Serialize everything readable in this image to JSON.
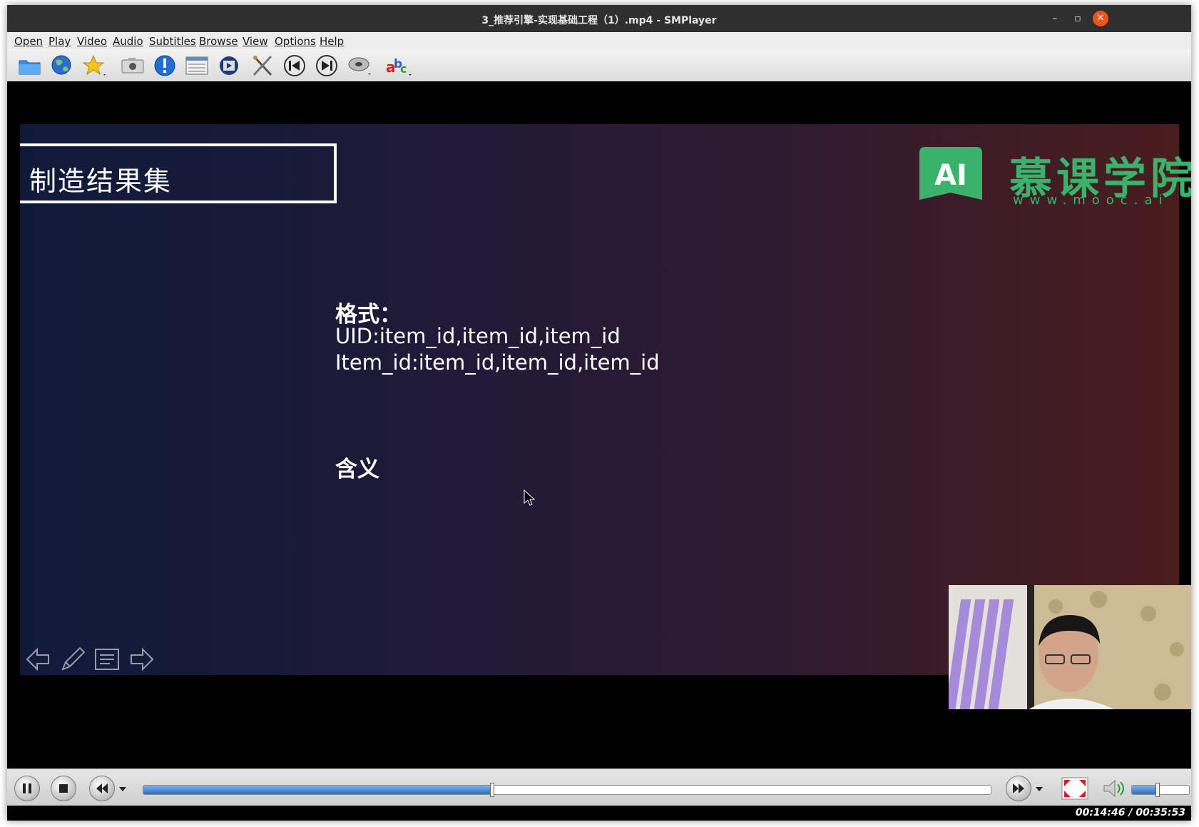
{
  "window": {
    "title": "3_推荐引擎-实现基础工程（1）.mp4 - SMPlayer",
    "close_color": "#e95420"
  },
  "menu": [
    "Open",
    "Play",
    "Video",
    "Audio",
    "Subtitles",
    "Browse",
    "View",
    "Options",
    "Help"
  ],
  "toolbar_icons": [
    "open-folder-icon",
    "globe-icon",
    "favorites-star-icon",
    "screenshot-camera-icon",
    "info-icon",
    "playlist-icon",
    "video-preferences-icon",
    "tools-icon",
    "previous-icon",
    "next-icon",
    "audio-disc-icon",
    "subtitles-icon"
  ],
  "slide": {
    "title": "制造结果集",
    "brand_name": "慕课学院",
    "brand_url": "www.mooc.ai",
    "brand_logo_text": "AI",
    "brand_color": "#39b36c",
    "format_heading": "格式：",
    "format_line_1": "UID:item_id,item_id,item_id",
    "format_line_2": "Item_id:item_id,item_id,item_id",
    "meaning_heading": "含义"
  },
  "playback": {
    "progress_fraction": 0.412,
    "volume_fraction": 0.45,
    "time_display": "00:14:46 / 00:35:53"
  }
}
